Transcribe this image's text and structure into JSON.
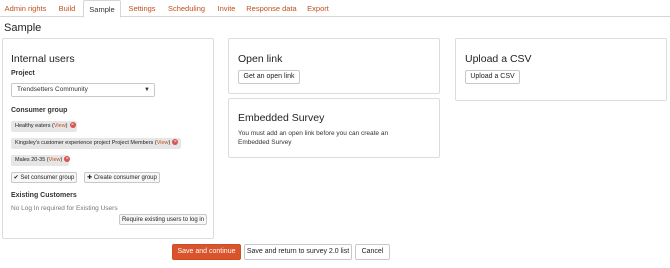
{
  "tabs": [
    "Admin rights",
    "Build",
    "Sample",
    "Settings",
    "Scheduling",
    "Invite",
    "Response data",
    "Export"
  ],
  "active_tab": "Sample",
  "page_title": "Sample",
  "internal_users": {
    "title": "Internal users",
    "project_label": "Project",
    "project_value": "Trendsetters Community",
    "consumer_group_label": "Consumer group",
    "groups": [
      {
        "name": "Healthy eaters",
        "view": "View"
      },
      {
        "name": "Kingsley's customer experience project Project Members",
        "view": "View"
      },
      {
        "name": "Males 20-35",
        "view": "View"
      }
    ],
    "set_group_label": "Set consumer group",
    "create_group_label": "Create consumer group",
    "existing_label": "Existing Customers",
    "existing_note": "No Log In required for Existing Users",
    "require_login_label": "Require existing users to log in"
  },
  "open_link": {
    "title": "Open link",
    "button": "Get an open link"
  },
  "embedded_survey": {
    "title": "Embedded Survey",
    "text": "You must add an open link before you can create an Embedded Survey"
  },
  "upload_csv": {
    "title": "Upload a CSV",
    "button": "Upload a CSV"
  },
  "footer": {
    "save_continue": "Save and continue",
    "save_return": "Save and return to survey 2.0 list",
    "cancel": "Cancel"
  },
  "colors": {
    "accent": "#c0501c",
    "primary_button": "#d9542b",
    "remove_icon": "#d9534f"
  }
}
